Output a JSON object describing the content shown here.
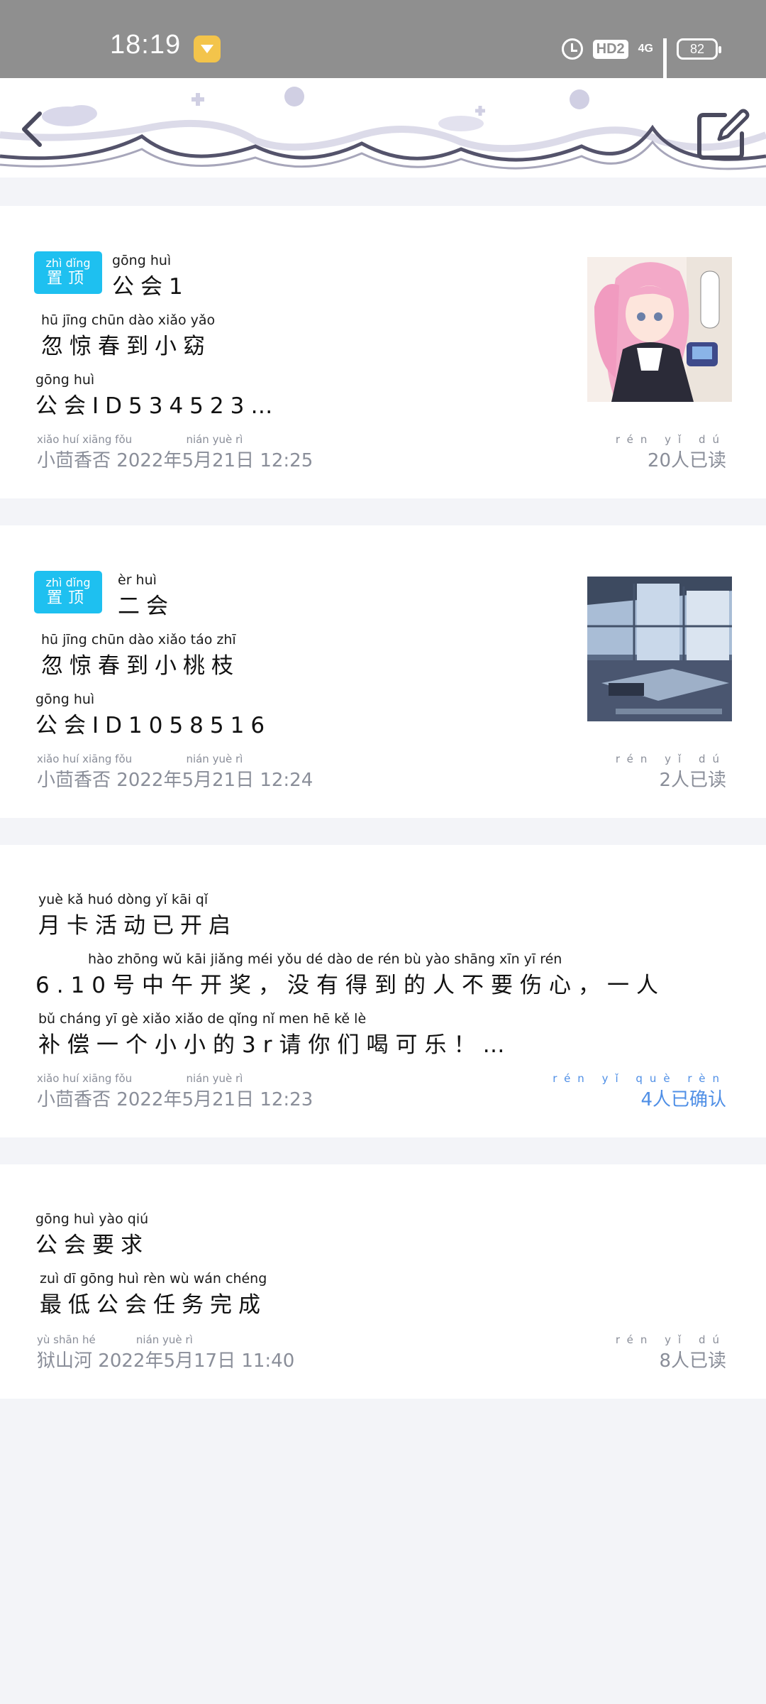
{
  "status_bar": {
    "time": "18:19",
    "hd_label": "HD2",
    "network_label": "4G",
    "battery": "82"
  },
  "colors": {
    "pin_badge": "#1ec0f0",
    "confirm_link": "#4f8fe6",
    "meta_text": "#8a8e99"
  },
  "header": {
    "back_icon": "chevron-left-icon",
    "edit_icon": "edit-icon"
  },
  "posts": [
    {
      "pinned": true,
      "pin_pinyin": "zhì dǐng",
      "pin_label": "置顶",
      "title_pinyin": "gōng huì",
      "title": "公会1",
      "line1_pinyin": "hū jīng chūn dào xiǎo yǎo",
      "line1": "忽惊春到小窈",
      "line2_pinyin": "gōng huì",
      "line2": "公会ID534523…",
      "author_pinyin": "xiǎo huí xiāng fǒu",
      "author": "小茴香否",
      "date_pinyin": "nián yuè rì",
      "date": "2022年5月21日 12:25",
      "read_pinyin": "rén yǐ dú",
      "read": "20人已读",
      "image": "anime-girl-pink-hair"
    },
    {
      "pinned": true,
      "pin_pinyin": "zhì dǐng",
      "pin_label": "置顶",
      "title_pinyin": "èr huì",
      "title": "二会",
      "line1_pinyin": "hū jīng chūn dào xiǎo táo zhī",
      "line1": "忽惊春到小桃枝",
      "line2_pinyin": "gōng huì",
      "line2": "公会ID1058516",
      "author_pinyin": "xiǎo huí xiāng fǒu",
      "author": "小茴香否",
      "date_pinyin": "nián yuè rì",
      "date": "2022年5月21日 12:24",
      "read_pinyin": "rén yǐ dú",
      "read": "2人已读",
      "image": "room-interior-window"
    },
    {
      "pinned": false,
      "title_pinyin": "yuè kǎ huó dòng yǐ kāi qǐ",
      "title": "月卡活动已开启",
      "line1_pinyin": "hào zhōng wǔ kāi jiǎng   méi yǒu dé dào de rén bù yào shāng xīn   yī rén",
      "line1": "6.10号中午开奖，没有得到的人不要伤心，一人",
      "line2_pinyin": "bǔ cháng yī gè xiǎo xiǎo de  qǐng nǐ men hē kě lè",
      "line2": "补偿一个小小的3r请你们喝可乐！…",
      "author_pinyin": "xiǎo huí xiāng fǒu",
      "author": "小茴香否",
      "date_pinyin": "nián yuè rì",
      "date": "2022年5月21日 12:23",
      "read_pinyin": "rén yǐ què rèn",
      "read": "4人已确认"
    },
    {
      "pinned": false,
      "title_pinyin": "gōng huì yào qiú",
      "title": "公会要求",
      "line1_pinyin": "zuì dī gōng huì rèn wù wán chéng",
      "line1": "最低公会任务完成",
      "author_pinyin": "yù shān hé",
      "author": "狱山河",
      "date_pinyin": "nián yuè rì",
      "date": "2022年5月17日 11:40",
      "read_pinyin": "rén yǐ dú",
      "read": "8人已读"
    }
  ]
}
